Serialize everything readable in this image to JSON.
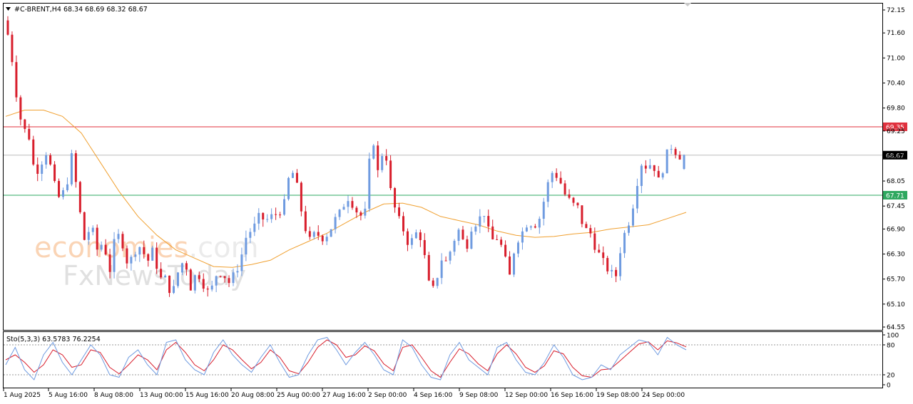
{
  "header": {
    "symbol_line": "#C-BRENT,H4  68.34 68.69 68.32 68.67",
    "indicator_line": "Sto(5,3,3) 63.5783 76.2254"
  },
  "watermark": {
    "brand_part1": "econo",
    "brand_part2": "mies",
    "brand_part3": ".com",
    "brand_line2": "FxNewsToday"
  },
  "colors": {
    "bull": "#6f9be0",
    "bear": "#d81e2c",
    "ma": "#f0a030",
    "resistance": "#e0313e",
    "support": "#2fa860",
    "current": "#bbbbbb",
    "stoch_main": "#6f9be0",
    "stoch_signal": "#d81e2c"
  },
  "chart_data": {
    "type": "line",
    "symbol": "#C-BRENT",
    "timeframe": "H4",
    "ohlc_last": {
      "open": 68.34,
      "high": 68.69,
      "low": 68.32,
      "close": 68.67
    },
    "ylim": [
      64.55,
      72.15
    ],
    "y_ticks": [
      "72.15",
      "71.60",
      "71.00",
      "70.40",
      "69.80",
      "69.25",
      "68.65",
      "68.05",
      "67.45",
      "66.90",
      "66.30",
      "65.70",
      "65.10",
      "64.55"
    ],
    "x_ticks": [
      "1 Aug 2025",
      "5 Aug 16:00",
      "8 Aug 08:00",
      "13 Aug 00:00",
      "15 Aug 16:00",
      "20 Aug 08:00",
      "25 Aug 00:00",
      "27 Aug 16:00",
      "2 Sep 00:00",
      "4 Sep 16:00",
      "9 Sep 08:00",
      "12 Sep 00:00",
      "16 Sep 16:00",
      "19 Sep 08:00",
      "24 Sep 00:00"
    ],
    "levels": [
      {
        "label": "69.35",
        "value": 69.35,
        "color": "#e0313e"
      },
      {
        "label": "68.67",
        "value": 68.67,
        "color": "#666666"
      },
      {
        "label": "67.71",
        "value": 67.71,
        "color": "#2fa860"
      }
    ],
    "close_path": [
      71.9,
      71.4,
      70.2,
      69.3,
      69.2,
      68.2,
      68.5,
      68.8,
      68.0,
      67.6,
      67.9,
      68.7,
      67.5,
      66.6,
      67.0,
      66.4,
      66.6,
      65.9,
      66.8,
      66.6,
      66.0,
      66.4,
      66.5,
      66.1,
      66.4,
      65.7,
      65.7,
      65.3,
      65.9,
      66.2,
      65.5,
      65.9,
      65.6,
      65.3,
      65.8,
      65.9,
      65.6,
      65.8,
      66.2,
      66.8,
      66.9,
      67.2,
      67.1,
      67.2,
      67.3,
      67.5,
      68.4,
      67.9,
      67.1,
      66.6,
      66.8,
      66.7,
      66.8,
      67.1,
      67.3,
      67.7,
      67.5,
      67.2,
      67.3,
      69.3,
      68.2,
      69.0,
      67.8,
      67.2,
      66.9,
      66.5,
      66.8,
      66.7,
      65.6,
      65.4,
      66.2,
      66.1,
      66.6,
      66.9,
      66.4,
      67.0,
      67.1,
      67.3,
      66.6,
      66.7,
      66.4,
      65.7,
      66.6,
      66.8,
      67.1,
      67.0,
      67.2,
      67.9,
      68.3,
      68.1,
      67.7,
      67.5,
      67.4,
      66.9,
      66.8,
      66.4,
      66.1,
      65.9,
      65.7,
      66.6,
      67.0,
      67.6,
      68.5,
      68.4,
      68.5,
      68.0,
      68.6,
      68.9,
      68.7,
      68.6
    ],
    "ma_path": [
      69.6,
      69.75,
      69.75,
      69.6,
      69.2,
      68.5,
      67.8,
      67.2,
      66.75,
      66.4,
      66.2,
      66.0,
      65.98,
      66.05,
      66.15,
      66.4,
      66.6,
      66.8,
      67.05,
      67.3,
      67.5,
      67.52,
      67.42,
      67.2,
      67.1,
      67.0,
      66.85,
      66.75,
      66.7,
      66.72,
      66.78,
      66.82,
      66.9,
      66.95,
      67.0,
      67.15,
      67.3
    ],
    "stochastic": {
      "params": "Sto(5,3,3)",
      "main": 63.5783,
      "signal": 76.2254,
      "levels": [
        80,
        20
      ],
      "scale_labels": [
        "100",
        "80",
        "20",
        "0"
      ],
      "main_path": [
        40,
        75,
        30,
        10,
        60,
        85,
        45,
        20,
        50,
        80,
        60,
        20,
        15,
        55,
        70,
        40,
        20,
        85,
        90,
        50,
        30,
        20,
        65,
        90,
        60,
        40,
        25,
        55,
        80,
        45,
        15,
        20,
        60,
        90,
        95,
        70,
        40,
        65,
        85,
        60,
        30,
        20,
        90,
        75,
        40,
        15,
        10,
        60,
        85,
        50,
        35,
        20,
        75,
        85,
        50,
        25,
        20,
        45,
        80,
        55,
        20,
        10,
        15,
        40,
        30,
        60,
        75,
        90,
        85,
        60,
        95,
        80,
        70
      ],
      "signal_path": [
        50,
        60,
        45,
        25,
        40,
        70,
        60,
        35,
        40,
        70,
        65,
        35,
        22,
        40,
        60,
        50,
        30,
        70,
        85,
        65,
        40,
        28,
        50,
        80,
        70,
        50,
        32,
        45,
        70,
        55,
        28,
        22,
        45,
        75,
        90,
        80,
        55,
        60,
        78,
        68,
        42,
        28,
        75,
        80,
        55,
        28,
        15,
        45,
        72,
        62,
        42,
        28,
        62,
        80,
        62,
        35,
        25,
        38,
        68,
        62,
        35,
        18,
        15,
        30,
        32,
        48,
        65,
        82,
        86,
        70,
        88,
        84,
        76
      ]
    }
  }
}
